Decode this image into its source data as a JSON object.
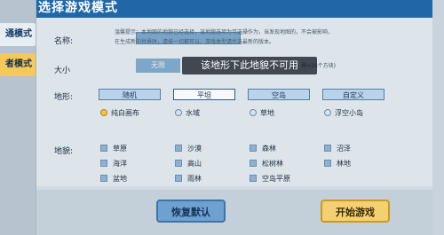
{
  "sidebar": {
    "tabs": [
      {
        "label": "通模式"
      },
      {
        "label": "者模式"
      }
    ]
  },
  "dialog": {
    "title": "选择游戏模式"
  },
  "form": {
    "name_label": "名称:",
    "name_value": "",
    "size_label": "大小",
    "size_value": "无限",
    "size_right_text": "界=16个方块)",
    "terrain_label": "地形:",
    "landform_label": "地貌:",
    "hint_line1": "温馨提示：本地图的地貌已经选择，该地貌选项为可选操作为，当发现地图的，不会被影响，",
    "hint_line2": "在生成新的世界时，请按一切都可以，游戏类型请优选最新的版本。"
  },
  "toast": {
    "text": "该地形下此地貌不可用"
  },
  "terrain_options": [
    {
      "label": "随机",
      "selected": false
    },
    {
      "label": "平坦",
      "selected": true
    },
    {
      "label": "空岛",
      "selected": false
    },
    {
      "label": "自定义",
      "selected": false
    }
  ],
  "flat_types": [
    {
      "label": "纯白画布",
      "selected": true
    },
    {
      "label": "水域",
      "selected": false
    },
    {
      "label": "草地",
      "selected": false
    },
    {
      "label": "浮空小岛",
      "selected": false
    }
  ],
  "landforms": [
    {
      "label": "草原"
    },
    {
      "label": "沙漠"
    },
    {
      "label": "森林"
    },
    {
      "label": "沼泽"
    },
    {
      "label": "海洋"
    },
    {
      "label": "高山"
    },
    {
      "label": "松树林"
    },
    {
      "label": "林地"
    },
    {
      "label": "盆地"
    },
    {
      "label": "雨林"
    },
    {
      "label": "空岛平原"
    }
  ],
  "footer": {
    "reset_label": "恢复默认",
    "start_label": "开始游戏"
  }
}
